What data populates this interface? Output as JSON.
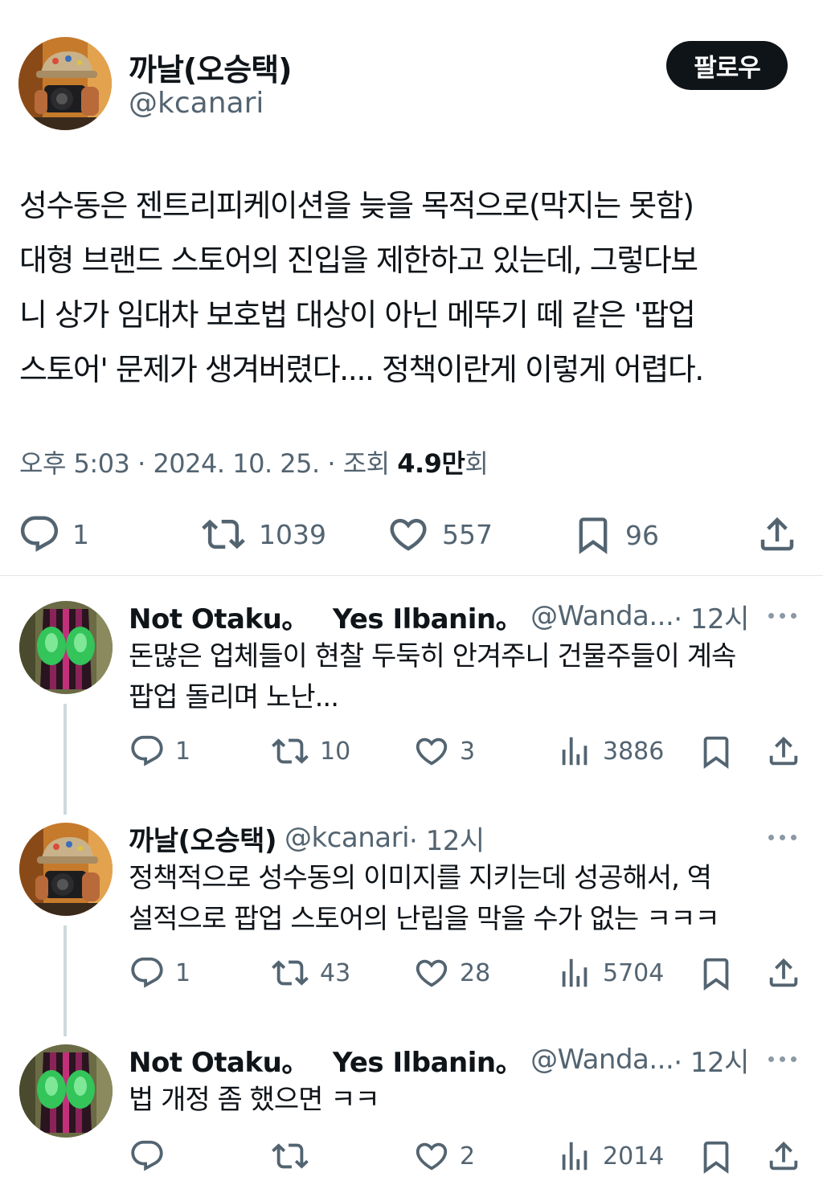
{
  "main_tweet": {
    "author_name": "까날(오승택)",
    "author_handle": "@kcanari",
    "follow_label": "팔로우",
    "text": "성수동은 젠트리피케이션을 늦을 목적으로(막지는 못함)\n대형 브랜드 스토어의 진입을 제한하고 있는데, 그렇다보\n니 상가 임대차 보호법 대상이 아닌 메뚜기 떼 같은 '팝업\n스토어' 문제가 생겨버렸다.... 정책이란게 이렇게 어렵다.",
    "time": "오후 5:03",
    "date": "2024. 10. 25.",
    "views_label": "조회",
    "views_count": "4.9만",
    "views_suffix": "회",
    "separator": "·",
    "replies": "1",
    "retweets": "1039",
    "likes": "557",
    "bookmarks": "96"
  },
  "replies": [
    {
      "name_part1": "Not Otaku。",
      "name_part2": "Yes Ilbanin。",
      "handle": "@Wanda...",
      "time": "· 12시",
      "text": "돈많은 업체들이 현찰 두둑히 안겨주니 건물주들이 계속\n팝업 돌리며 노난...",
      "replies": "1",
      "retweets": "10",
      "likes": "3",
      "views": "3886"
    },
    {
      "name": "까날(오승택)",
      "handle": "@kcanari",
      "time": "· 12시",
      "text": "정책적으로 성수동의 이미지를 지키는데 성공해서, 역\n설적으로 팝업 스토어의 난립을 막을 수가 없는 ㅋㅋㅋ",
      "replies": "1",
      "retweets": "43",
      "likes": "28",
      "views": "5704"
    },
    {
      "name_part1": "Not Otaku。",
      "name_part2": "Yes Ilbanin。",
      "handle": "@Wanda...",
      "time": "· 12시",
      "text": "법 개정 좀 했으면 ㅋㅋ",
      "replies": "",
      "retweets": "",
      "likes": "2",
      "views": "2014"
    }
  ],
  "icons": [
    "reply-icon",
    "retweet-icon",
    "like-icon",
    "bookmark-icon",
    "share-icon",
    "views-icon",
    "more-icon"
  ],
  "colors": {
    "text": "#0f1419",
    "secondary": "#536471",
    "follow_bg": "#0f1419",
    "divider": "#e3e6ea",
    "thread_line": "#cfd9de"
  }
}
